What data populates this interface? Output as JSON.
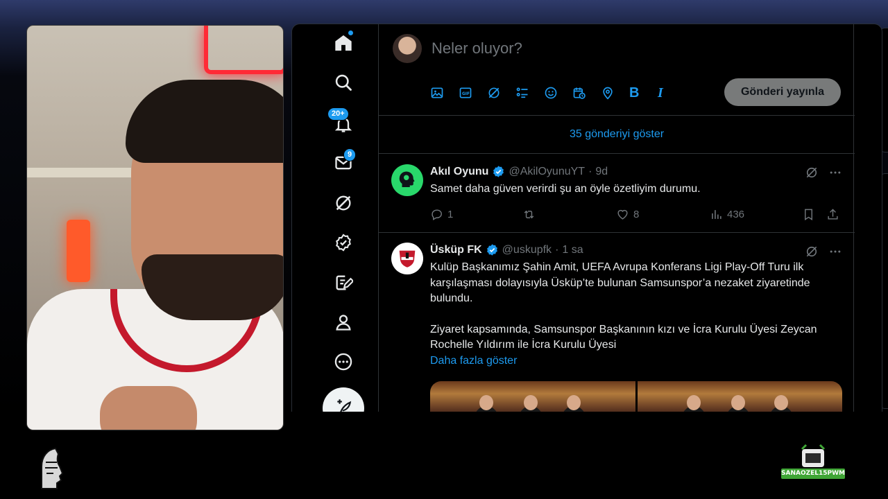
{
  "composer": {
    "placeholder": "Neler oluyor?",
    "post_button": "Gönderi yayınla",
    "tools": [
      "image-icon",
      "gif-icon",
      "grok-icon",
      "list-icon",
      "emoji-icon",
      "schedule-icon",
      "location-icon",
      "bold-icon",
      "italic-icon"
    ],
    "bold_label": "B",
    "italic_label": "I"
  },
  "nav": {
    "notifications_badge": "20+",
    "messages_badge": "9"
  },
  "timeline": {
    "show_new_posts": "35 gönderiyi göster"
  },
  "tweets": [
    {
      "name": "Akıl Oyunu",
      "handle": "@AkilOyunuYT",
      "sep": "·",
      "time": "9d",
      "text": "Samet daha güven verirdi şu an öyle özetliyim durumu.",
      "replies": "1",
      "likes": "8",
      "views": "436"
    },
    {
      "name": "Üsküp FK",
      "handle": "@uskupfk",
      "sep": "·",
      "time": "1 sa",
      "text_p1": "Kulüp Başkanımız Şahin Amit, UEFA Avrupa Konferans Ligi Play-Off Turu ilk karşılaşması dolayısıyla Üsküp’te bulunan Samsunspor’a nezaket ziyaretinde bulundu.",
      "text_p2": "Ziyaret kapsamında, Samsunspor Başkanının kızı ve İcra Kurulu Üyesi Zeycan Rochelle Yıldırım ile İcra Kurulu Üyesi",
      "show_more": "Daha fazla göster"
    }
  ],
  "overlay": {
    "sticker_label": "SANAOZEL15PWM"
  },
  "colors": {
    "accent": "#1d9bf0",
    "background": "#000000",
    "divider": "#2f3336",
    "muted_text": "#71767b"
  }
}
